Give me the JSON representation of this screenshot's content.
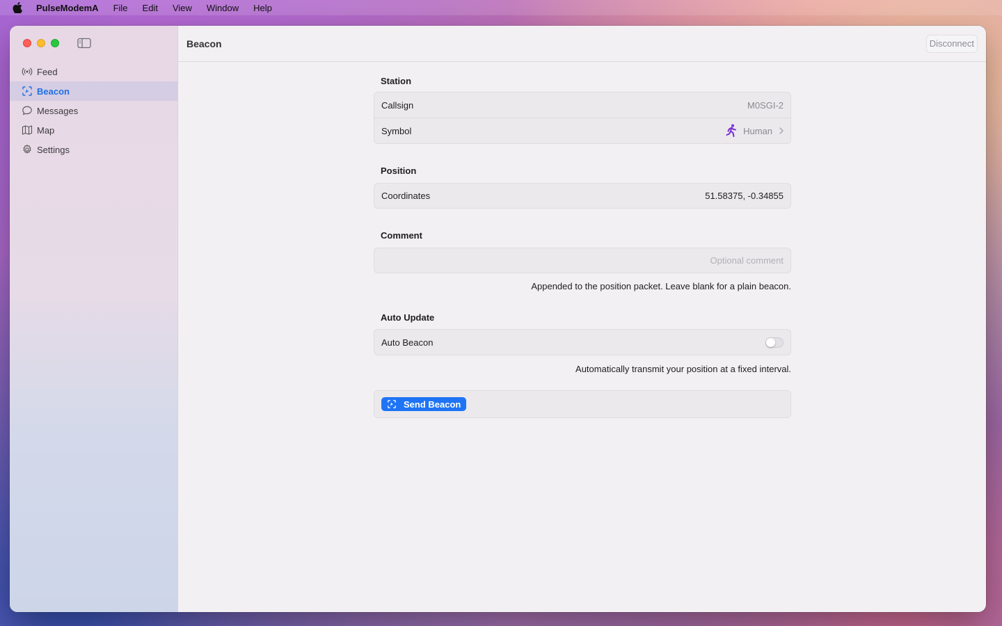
{
  "menubar": {
    "app_name": "PulseModemA",
    "items": [
      "File",
      "Edit",
      "View",
      "Window",
      "Help"
    ]
  },
  "toolbar": {
    "title": "Beacon",
    "disconnect_label": "Disconnect"
  },
  "sidebar": {
    "items": [
      {
        "label": "Feed",
        "icon": "antenna-icon"
      },
      {
        "label": "Beacon",
        "icon": "beacon-icon",
        "active": true
      },
      {
        "label": "Messages",
        "icon": "message-bubble-icon"
      },
      {
        "label": "Map",
        "icon": "map-icon"
      },
      {
        "label": "Settings",
        "icon": "gear-icon"
      }
    ]
  },
  "station": {
    "header": "Station",
    "callsign_label": "Callsign",
    "callsign_value": "M0SGI-2",
    "symbol_label": "Symbol",
    "symbol_value": "Human",
    "symbol_icon": "running-person-icon"
  },
  "position": {
    "header": "Position",
    "coordinates_label": "Coordinates",
    "coordinates_value": "51.58375, -0.34855"
  },
  "comment": {
    "header": "Comment",
    "placeholder": "Optional comment",
    "value": "",
    "caption": "Appended to the position packet. Leave blank for a plain beacon."
  },
  "auto_update": {
    "header": "Auto Update",
    "auto_beacon_label": "Auto Beacon",
    "auto_beacon_enabled": false,
    "caption": "Automatically transmit your position at a fixed interval."
  },
  "actions": {
    "send_label": "Send Beacon"
  },
  "colors": {
    "accent": "#1e74f4",
    "symbol_purple": "#7b2fd6",
    "close": "#fe5f57",
    "minimize": "#febc2e",
    "zoom": "#28c840"
  }
}
